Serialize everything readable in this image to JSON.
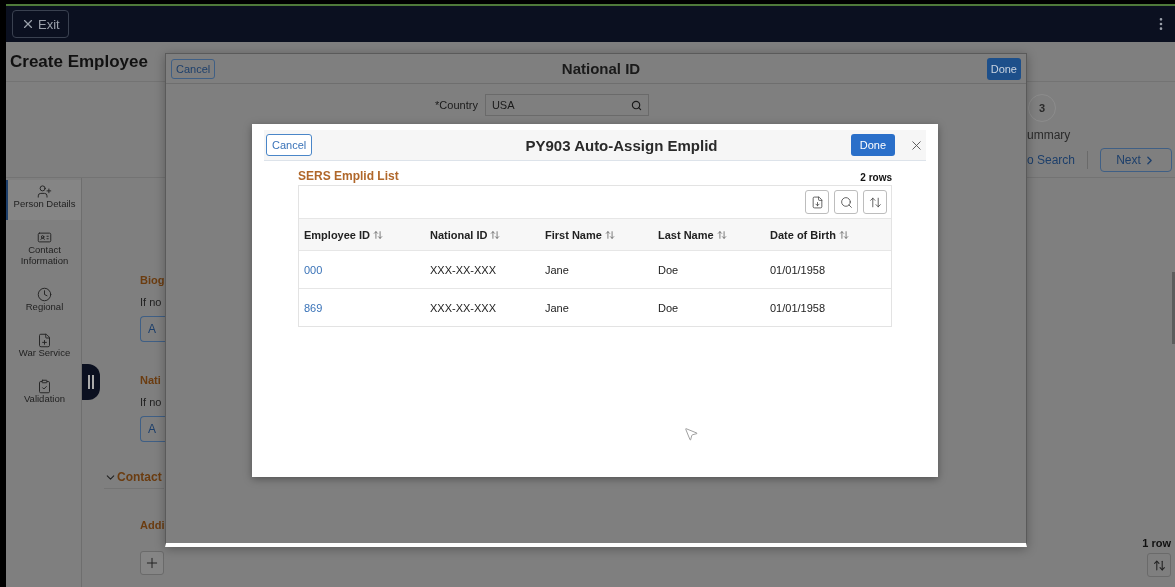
{
  "top_bar": {
    "exit_button": "Exit"
  },
  "page": {
    "title": "Create Employee"
  },
  "sidebar": {
    "items": [
      {
        "label": "Person Details",
        "selected": true
      },
      {
        "label": "Contact Information",
        "selected": false
      },
      {
        "label": "Regional",
        "selected": false
      },
      {
        "label": "War Service",
        "selected": false
      },
      {
        "label": "Validation",
        "selected": false
      }
    ]
  },
  "content_left": {
    "sections": [
      {
        "kind": "group",
        "heading": "Biog",
        "note": "If no",
        "button": "A"
      },
      {
        "kind": "group",
        "heading": "Nati",
        "note": "If no",
        "button": "A"
      },
      {
        "kind": "collapsible",
        "heading": "Contact",
        "expanded": true
      },
      {
        "kind": "subgroup",
        "heading": "Addi"
      }
    ]
  },
  "steps_right": {
    "step_number": "3",
    "step_label": "ummary",
    "back_link": "o Search",
    "next_button": "Next"
  },
  "address_grid": {
    "row_count": "1 row"
  },
  "national_id_modal": {
    "cancel": "Cancel",
    "title": "National ID",
    "done": "Done",
    "country_label": "*Country",
    "country_value": "USA"
  },
  "emplid_modal": {
    "cancel": "Cancel",
    "title": "PY903 Auto-Assign Emplid",
    "done": "Done",
    "list_title": "SERS Emplid List",
    "row_count": "2 rows",
    "columns": [
      "Employee ID",
      "National ID",
      "First Name",
      "Last Name",
      "Date of Birth"
    ],
    "rows": [
      [
        "000",
        "XXX-XX-XXX",
        "Jane",
        "Doe",
        "01/01/1958"
      ],
      [
        "869",
        "XXX-XX-XXX",
        "Jane",
        "Doe",
        "01/01/1958"
      ]
    ]
  }
}
